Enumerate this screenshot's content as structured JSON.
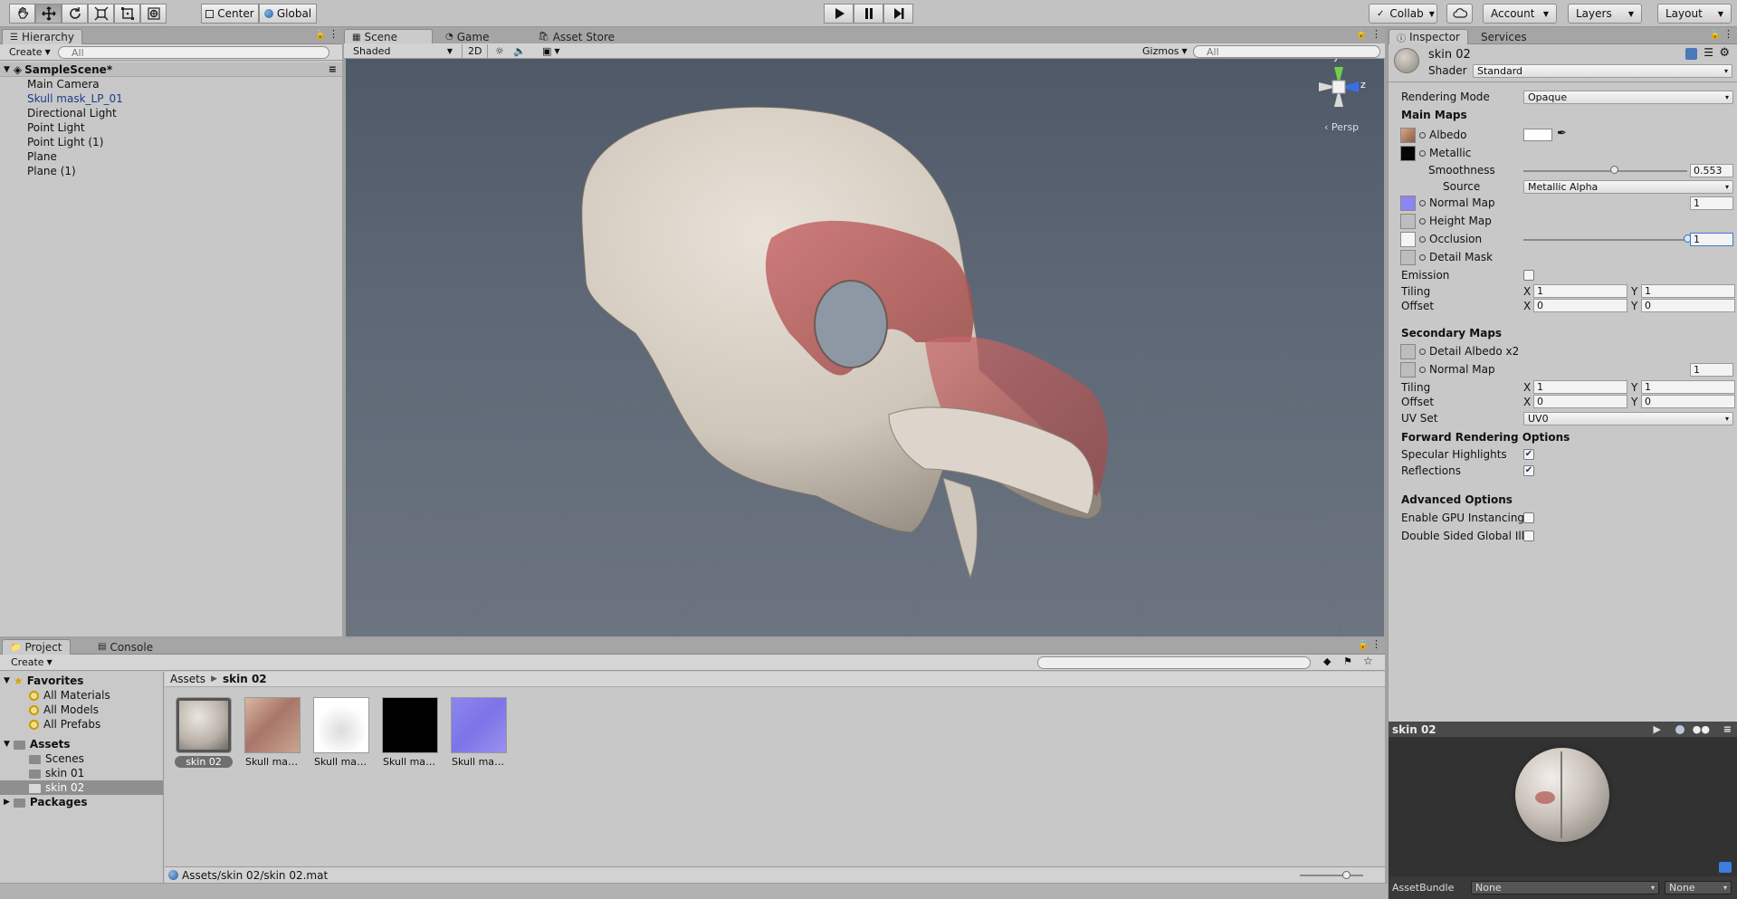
{
  "toolbar": {
    "transform_tools": [
      "hand-tool-icon",
      "move-tool-icon",
      "rotate-tool-icon",
      "scale-tool-icon",
      "rect-tool-icon",
      "transform-tool-icon"
    ],
    "pivot_label": "Center",
    "space_label": "Global",
    "collab_label": "Collab",
    "account_label": "Account",
    "layers_label": "Layers",
    "layout_label": "Layout"
  },
  "hierarchy": {
    "tab_label": "Hierarchy",
    "create_label": "Create",
    "search_placeholder": "All",
    "scene_name": "SampleScene*",
    "items": [
      "Main Camera",
      "Skull mask_LP_01",
      "Directional Light",
      "Point Light",
      "Point Light (1)",
      "Plane",
      "Plane (1)"
    ]
  },
  "scene_view": {
    "tabs": [
      "Scene",
      "Game",
      "Asset Store"
    ],
    "shading_mode": "Shaded",
    "mode_2d": "2D",
    "gizmos_label": "Gizmos",
    "search_placeholder": "All",
    "axis_y": "y",
    "axis_z": "z",
    "projection_label": "Persp"
  },
  "inspector": {
    "tabs": [
      "Inspector",
      "Services"
    ],
    "material_name": "skin 02",
    "shader_label": "Shader",
    "shader_value": "Standard",
    "rendering_mode_label": "Rendering Mode",
    "rendering_mode_value": "Opaque",
    "main_maps_header": "Main Maps",
    "albedo_label": "Albedo",
    "metallic_label": "Metallic",
    "smoothness_label": "Smoothness",
    "smoothness_value": "0.553",
    "smoothness_fraction": 0.553,
    "source_label": "Source",
    "source_value": "Metallic Alpha",
    "normal_map_label": "Normal Map",
    "normal_map_value": "1",
    "height_map_label": "Height Map",
    "occlusion_label": "Occlusion",
    "occlusion_value": "1",
    "occlusion_fraction": 1,
    "detail_mask_label": "Detail Mask",
    "emission_label": "Emission",
    "tiling_label": "Tiling",
    "offset_label": "Offset",
    "x_label": "X",
    "y_label": "Y",
    "tiling_x": "1",
    "tiling_y": "1",
    "offset_x": "0",
    "offset_y": "0",
    "secondary_maps_header": "Secondary Maps",
    "detail_albedo_label": "Detail Albedo x2",
    "sec_normal_map_label": "Normal Map",
    "sec_normal_map_value": "1",
    "sec_tiling_x": "1",
    "sec_tiling_y": "1",
    "sec_offset_x": "0",
    "sec_offset_y": "0",
    "uv_set_label": "UV Set",
    "uv_set_value": "UV0",
    "forward_header": "Forward Rendering Options",
    "specular_label": "Specular Highlights",
    "specular_checked": true,
    "reflections_label": "Reflections",
    "reflections_checked": true,
    "advanced_header": "Advanced Options",
    "gpu_instancing_label": "Enable GPU Instancing",
    "double_sided_label": "Double Sided Global Ill",
    "preview_title": "skin 02",
    "assetbundle_label": "AssetBundle",
    "assetbundle_value": "None",
    "assetbundle_variant": "None"
  },
  "project": {
    "tabs": [
      "Project",
      "Console"
    ],
    "create_label": "Create",
    "favorites_label": "Favorites",
    "favorites": [
      "All Materials",
      "All Models",
      "All Prefabs"
    ],
    "assets_label": "Assets",
    "asset_folders": [
      "Scenes",
      "skin 01",
      "skin 02"
    ],
    "packages_label": "Packages",
    "breadcrumb_root": "Assets",
    "breadcrumb_current": "skin 02",
    "assets": [
      "skin 02",
      "Skull mask...",
      "Skull mask...",
      "Skull mask...",
      "Skull mask..."
    ],
    "status_path": "Assets/skin 02/skin 02.mat"
  },
  "colors": {
    "selection": "#6f6f6f",
    "link_blue": "#1a3c8c",
    "normal_map_tint": "#8a86f4"
  }
}
